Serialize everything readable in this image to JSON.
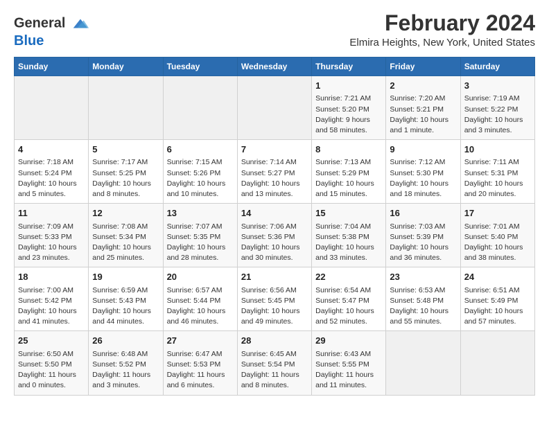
{
  "header": {
    "logo_line1": "General",
    "logo_line2": "Blue",
    "title": "February 2024",
    "subtitle": "Elmira Heights, New York, United States"
  },
  "days_of_week": [
    "Sunday",
    "Monday",
    "Tuesday",
    "Wednesday",
    "Thursday",
    "Friday",
    "Saturday"
  ],
  "weeks": [
    [
      {
        "day": "",
        "info": ""
      },
      {
        "day": "",
        "info": ""
      },
      {
        "day": "",
        "info": ""
      },
      {
        "day": "",
        "info": ""
      },
      {
        "day": "1",
        "info": "Sunrise: 7:21 AM\nSunset: 5:20 PM\nDaylight: 9 hours\nand 58 minutes."
      },
      {
        "day": "2",
        "info": "Sunrise: 7:20 AM\nSunset: 5:21 PM\nDaylight: 10 hours\nand 1 minute."
      },
      {
        "day": "3",
        "info": "Sunrise: 7:19 AM\nSunset: 5:22 PM\nDaylight: 10 hours\nand 3 minutes."
      }
    ],
    [
      {
        "day": "4",
        "info": "Sunrise: 7:18 AM\nSunset: 5:24 PM\nDaylight: 10 hours\nand 5 minutes."
      },
      {
        "day": "5",
        "info": "Sunrise: 7:17 AM\nSunset: 5:25 PM\nDaylight: 10 hours\nand 8 minutes."
      },
      {
        "day": "6",
        "info": "Sunrise: 7:15 AM\nSunset: 5:26 PM\nDaylight: 10 hours\nand 10 minutes."
      },
      {
        "day": "7",
        "info": "Sunrise: 7:14 AM\nSunset: 5:27 PM\nDaylight: 10 hours\nand 13 minutes."
      },
      {
        "day": "8",
        "info": "Sunrise: 7:13 AM\nSunset: 5:29 PM\nDaylight: 10 hours\nand 15 minutes."
      },
      {
        "day": "9",
        "info": "Sunrise: 7:12 AM\nSunset: 5:30 PM\nDaylight: 10 hours\nand 18 minutes."
      },
      {
        "day": "10",
        "info": "Sunrise: 7:11 AM\nSunset: 5:31 PM\nDaylight: 10 hours\nand 20 minutes."
      }
    ],
    [
      {
        "day": "11",
        "info": "Sunrise: 7:09 AM\nSunset: 5:33 PM\nDaylight: 10 hours\nand 23 minutes."
      },
      {
        "day": "12",
        "info": "Sunrise: 7:08 AM\nSunset: 5:34 PM\nDaylight: 10 hours\nand 25 minutes."
      },
      {
        "day": "13",
        "info": "Sunrise: 7:07 AM\nSunset: 5:35 PM\nDaylight: 10 hours\nand 28 minutes."
      },
      {
        "day": "14",
        "info": "Sunrise: 7:06 AM\nSunset: 5:36 PM\nDaylight: 10 hours\nand 30 minutes."
      },
      {
        "day": "15",
        "info": "Sunrise: 7:04 AM\nSunset: 5:38 PM\nDaylight: 10 hours\nand 33 minutes."
      },
      {
        "day": "16",
        "info": "Sunrise: 7:03 AM\nSunset: 5:39 PM\nDaylight: 10 hours\nand 36 minutes."
      },
      {
        "day": "17",
        "info": "Sunrise: 7:01 AM\nSunset: 5:40 PM\nDaylight: 10 hours\nand 38 minutes."
      }
    ],
    [
      {
        "day": "18",
        "info": "Sunrise: 7:00 AM\nSunset: 5:42 PM\nDaylight: 10 hours\nand 41 minutes."
      },
      {
        "day": "19",
        "info": "Sunrise: 6:59 AM\nSunset: 5:43 PM\nDaylight: 10 hours\nand 44 minutes."
      },
      {
        "day": "20",
        "info": "Sunrise: 6:57 AM\nSunset: 5:44 PM\nDaylight: 10 hours\nand 46 minutes."
      },
      {
        "day": "21",
        "info": "Sunrise: 6:56 AM\nSunset: 5:45 PM\nDaylight: 10 hours\nand 49 minutes."
      },
      {
        "day": "22",
        "info": "Sunrise: 6:54 AM\nSunset: 5:47 PM\nDaylight: 10 hours\nand 52 minutes."
      },
      {
        "day": "23",
        "info": "Sunrise: 6:53 AM\nSunset: 5:48 PM\nDaylight: 10 hours\nand 55 minutes."
      },
      {
        "day": "24",
        "info": "Sunrise: 6:51 AM\nSunset: 5:49 PM\nDaylight: 10 hours\nand 57 minutes."
      }
    ],
    [
      {
        "day": "25",
        "info": "Sunrise: 6:50 AM\nSunset: 5:50 PM\nDaylight: 11 hours\nand 0 minutes."
      },
      {
        "day": "26",
        "info": "Sunrise: 6:48 AM\nSunset: 5:52 PM\nDaylight: 11 hours\nand 3 minutes."
      },
      {
        "day": "27",
        "info": "Sunrise: 6:47 AM\nSunset: 5:53 PM\nDaylight: 11 hours\nand 6 minutes."
      },
      {
        "day": "28",
        "info": "Sunrise: 6:45 AM\nSunset: 5:54 PM\nDaylight: 11 hours\nand 8 minutes."
      },
      {
        "day": "29",
        "info": "Sunrise: 6:43 AM\nSunset: 5:55 PM\nDaylight: 11 hours\nand 11 minutes."
      },
      {
        "day": "",
        "info": ""
      },
      {
        "day": "",
        "info": ""
      }
    ]
  ]
}
